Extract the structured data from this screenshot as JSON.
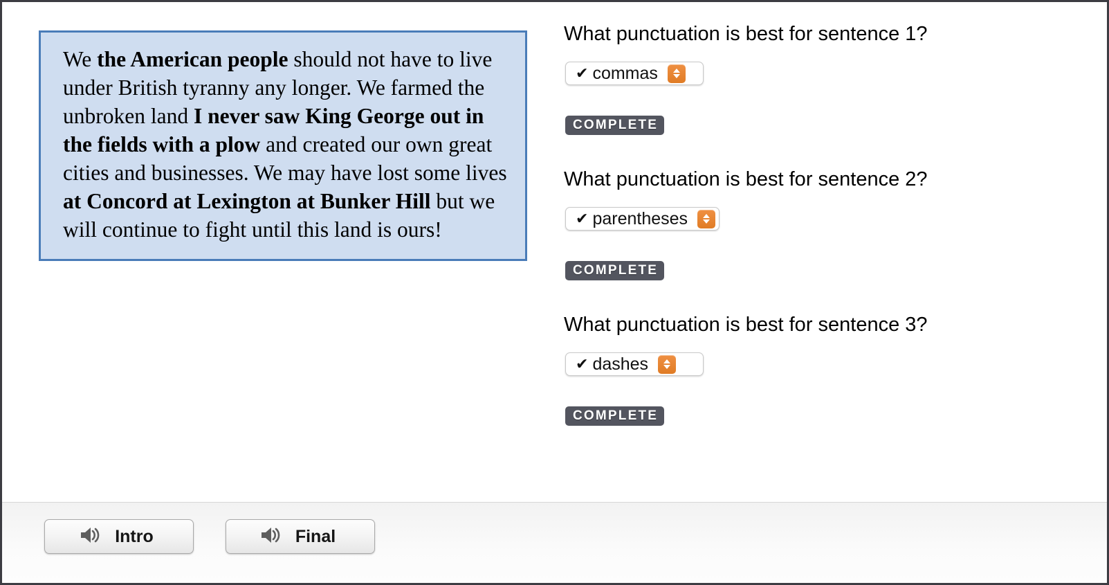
{
  "passage": {
    "segments": [
      {
        "text": "We ",
        "bold": false
      },
      {
        "text": "the American people",
        "bold": true
      },
      {
        "text": " should not have to live under British tyranny any longer. We farmed the unbroken land ",
        "bold": false
      },
      {
        "text": "I never saw King George out in the fields with a plow",
        "bold": true
      },
      {
        "text": " and created our own great cities and businesses. We may have lost some lives ",
        "bold": false
      },
      {
        "text": "at Concord at Lexington at Bunker Hill",
        "bold": true
      },
      {
        "text": " but we will continue to fight until this land is ours!",
        "bold": false
      }
    ],
    "plain_text": "We the American people should not have to live under British tyranny any longer. We farmed the unbroken land I never saw King George out in the fields with a plow and created our own great cities and businesses. We may have lost some lives at Concord at Lexington at Bunker Hill but we will continue to fight until this land is ours!",
    "background_color": "#cfddf0",
    "border_color": "#4a7cb8"
  },
  "questions": [
    {
      "label": "What punctuation is best for sentence 1?",
      "answer_prefix": "✔",
      "answer": "commas",
      "status": "COMPLETE"
    },
    {
      "label": "What punctuation is best for sentence 2?",
      "answer_prefix": "✔",
      "answer": "parentheses",
      "status": "COMPLETE"
    },
    {
      "label": "What punctuation is best for sentence 3?",
      "answer_prefix": "✔",
      "answer": "dashes",
      "status": "COMPLETE"
    }
  ],
  "footer": {
    "buttons": [
      {
        "label": "Intro",
        "icon": "speaker-icon"
      },
      {
        "label": "Final",
        "icon": "speaker-icon"
      }
    ]
  },
  "colors": {
    "accent_orange": "#e07c25",
    "badge_slate": "#53555f",
    "passage_blue": "#cfddf0",
    "passage_border_blue": "#4a7cb8",
    "page_border": "#3c3c42"
  }
}
